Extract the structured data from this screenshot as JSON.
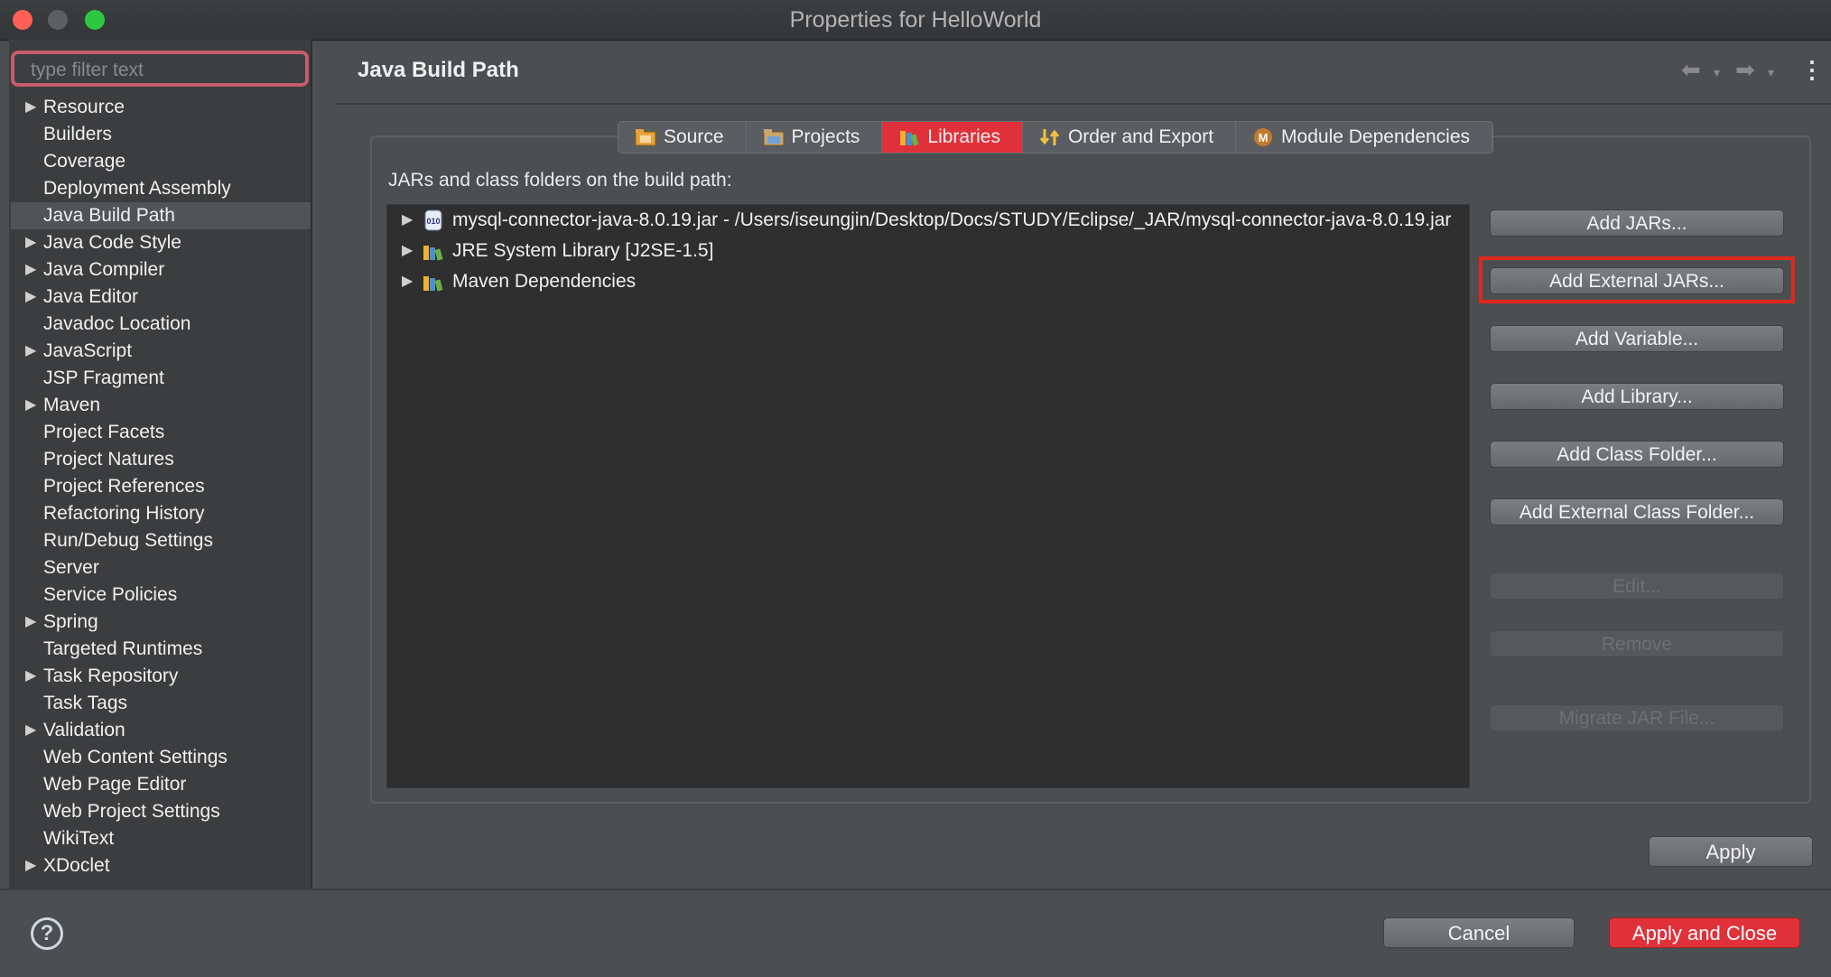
{
  "window": {
    "title": "Properties for HelloWorld"
  },
  "sidebar": {
    "filter_placeholder": "type filter text",
    "items": [
      {
        "label": "Resource",
        "expandable": true
      },
      {
        "label": "Builders",
        "expandable": false
      },
      {
        "label": "Coverage",
        "expandable": false
      },
      {
        "label": "Deployment Assembly",
        "expandable": false
      },
      {
        "label": "Java Build Path",
        "expandable": false,
        "selected": true
      },
      {
        "label": "Java Code Style",
        "expandable": true
      },
      {
        "label": "Java Compiler",
        "expandable": true
      },
      {
        "label": "Java Editor",
        "expandable": true
      },
      {
        "label": "Javadoc Location",
        "expandable": false
      },
      {
        "label": "JavaScript",
        "expandable": true
      },
      {
        "label": "JSP Fragment",
        "expandable": false
      },
      {
        "label": "Maven",
        "expandable": true
      },
      {
        "label": "Project Facets",
        "expandable": false
      },
      {
        "label": "Project Natures",
        "expandable": false
      },
      {
        "label": "Project References",
        "expandable": false
      },
      {
        "label": "Refactoring History",
        "expandable": false
      },
      {
        "label": "Run/Debug Settings",
        "expandable": false
      },
      {
        "label": "Server",
        "expandable": false
      },
      {
        "label": "Service Policies",
        "expandable": false
      },
      {
        "label": "Spring",
        "expandable": true
      },
      {
        "label": "Targeted Runtimes",
        "expandable": false
      },
      {
        "label": "Task Repository",
        "expandable": true
      },
      {
        "label": "Task Tags",
        "expandable": false
      },
      {
        "label": "Validation",
        "expandable": true
      },
      {
        "label": "Web Content Settings",
        "expandable": false
      },
      {
        "label": "Web Page Editor",
        "expandable": false
      },
      {
        "label": "Web Project Settings",
        "expandable": false
      },
      {
        "label": "WikiText",
        "expandable": false
      },
      {
        "label": "XDoclet",
        "expandable": true
      }
    ]
  },
  "main": {
    "heading": "Java Build Path",
    "tabs": [
      {
        "label": "Source",
        "icon": "source-folder-icon"
      },
      {
        "label": "Projects",
        "icon": "projects-folder-icon"
      },
      {
        "label": "Libraries",
        "icon": "libraries-icon",
        "active": true
      },
      {
        "label": "Order and Export",
        "icon": "order-export-icon"
      },
      {
        "label": "Module Dependencies",
        "icon": "module-icon"
      }
    ],
    "path_label": "JARs and class folders on the build path:",
    "libraries": [
      {
        "label": "mysql-connector-java-8.0.19.jar - /Users/iseungjin/Desktop/Docs/STUDY/Eclipse/_JAR/mysql-connector-java-8.0.19.jar",
        "icon": "jar-file-icon"
      },
      {
        "label": "JRE System Library [J2SE-1.5]",
        "icon": "library-icon"
      },
      {
        "label": "Maven Dependencies",
        "icon": "library-icon"
      }
    ],
    "buttons": [
      {
        "label": "Add JARs...",
        "enabled": true
      },
      {
        "label": "Add External JARs...",
        "enabled": true,
        "highlighted": true
      },
      {
        "label": "Add Variable...",
        "enabled": true
      },
      {
        "label": "Add Library...",
        "enabled": true
      },
      {
        "label": "Add Class Folder...",
        "enabled": true
      },
      {
        "label": "Add External Class Folder...",
        "enabled": true
      },
      {
        "label": "Edit...",
        "enabled": false
      },
      {
        "label": "Remove",
        "enabled": false
      },
      {
        "label": "Migrate JAR File...",
        "enabled": false
      }
    ],
    "apply_label": "Apply"
  },
  "footer": {
    "help_glyph": "?",
    "cancel_label": "Cancel",
    "apply_close_label": "Apply and Close"
  },
  "colors": {
    "accent": "#e0313a",
    "highlight_box": "#e0281e"
  }
}
